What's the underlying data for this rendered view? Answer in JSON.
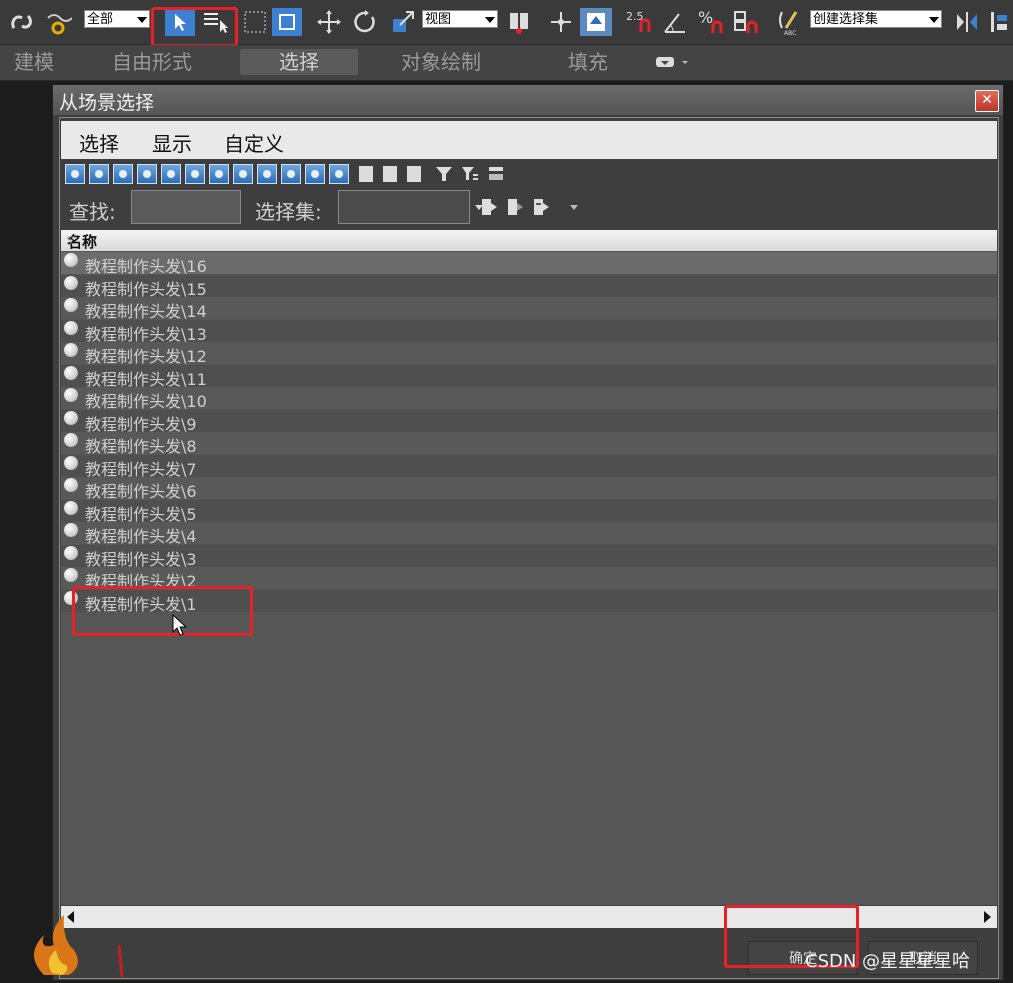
{
  "toolbar": {
    "filter_value": "全部",
    "coord_value": "视图",
    "selection_set_value": "创建选择集",
    "snap_label": "2.5",
    "percent_label": "%"
  },
  "ribbon": {
    "tabs": [
      {
        "label": "建模"
      },
      {
        "label": "自由形式"
      },
      {
        "label": "选择"
      },
      {
        "label": "对象绘制"
      },
      {
        "label": "填充"
      }
    ]
  },
  "dialog": {
    "title": "从场景选择",
    "close_label": "✕",
    "menu": [
      {
        "label": "选择"
      },
      {
        "label": "显示"
      },
      {
        "label": "自定义"
      }
    ],
    "find_label": "查找:",
    "selset_label": "选择集:",
    "column_header": "名称",
    "items": [
      {
        "name": "教程制作头发\\16"
      },
      {
        "name": "教程制作头发\\15"
      },
      {
        "name": "教程制作头发\\14"
      },
      {
        "name": "教程制作头发\\13"
      },
      {
        "name": "教程制作头发\\12"
      },
      {
        "name": "教程制作头发\\11"
      },
      {
        "name": "教程制作头发\\10"
      },
      {
        "name": "教程制作头发\\9"
      },
      {
        "name": "教程制作头发\\8"
      },
      {
        "name": "教程制作头发\\7"
      },
      {
        "name": "教程制作头发\\6"
      },
      {
        "name": "教程制作头发\\5"
      },
      {
        "name": "教程制作头发\\4"
      },
      {
        "name": "教程制作头发\\3"
      },
      {
        "name": "教程制作头发\\2"
      },
      {
        "name": "教程制作头发\\1"
      }
    ],
    "ok_label": "确定",
    "cancel_label": "取消"
  },
  "watermark": "CSDN @星星星星哈",
  "colors": {
    "highlight_red": "#e8202a",
    "accent_blue": "#3d7fd0"
  }
}
